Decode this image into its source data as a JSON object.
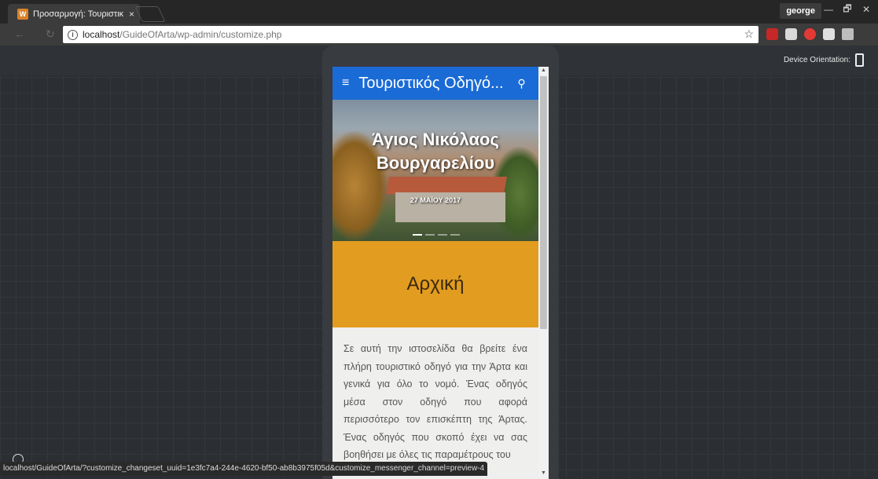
{
  "browser": {
    "tab_title": "Προσαρμογή: Τουριστικ",
    "tab_close": "×",
    "profile": "george",
    "window_buttons": [
      "—",
      "🗗",
      "✕"
    ],
    "url_host": "localhost",
    "url_path": "/GuideOfArta/wp-admin/customize.php",
    "status_url": "localhost/GuideOfArta/?customize_changeset_uuid=1e3fc7a4-244e-4620-bf50-ab8b3975f05d&customize_messenger_channel=preview-4",
    "extensions": [
      {
        "icon": "bookmark-ext-icon",
        "color": "#c62828"
      },
      {
        "icon": "s-ext-icon",
        "color": "#d9d9d9"
      },
      {
        "icon": "opera-ext-icon",
        "color": "#e53935"
      },
      {
        "icon": "tools-ext-icon",
        "color": "#e0e0e0"
      },
      {
        "icon": "drive-ext-icon",
        "color": "#bdbdbd"
      }
    ]
  },
  "customizer": {
    "device_orientation_label": "Device Orientation:"
  },
  "site": {
    "title": "Τουριστικός Οδηγό...",
    "menu_icon": "≡",
    "hero_title": "Άγιος Νικόλαος Βουργαρελίου",
    "hero_date": "27 ΜΑΪΟΥ 2017",
    "page_title": "Αρχική",
    "content_text": "Σε αυτή την ιστοσελίδα θα βρείτε ένα πλήρη τουριστικό οδηγό για την Άρτα και γενικά για όλο το νομό. Ένας οδηγός μέσα στον οδηγό που αφορά περισσότερο τον επισκέπτη της Άρτας. Ένας οδηγός που σκοπό έχει να σας βοηθήσει με όλες τις παραμέτρους του",
    "header_color": "#1a6bd6",
    "banner_color": "#e29c1f"
  }
}
